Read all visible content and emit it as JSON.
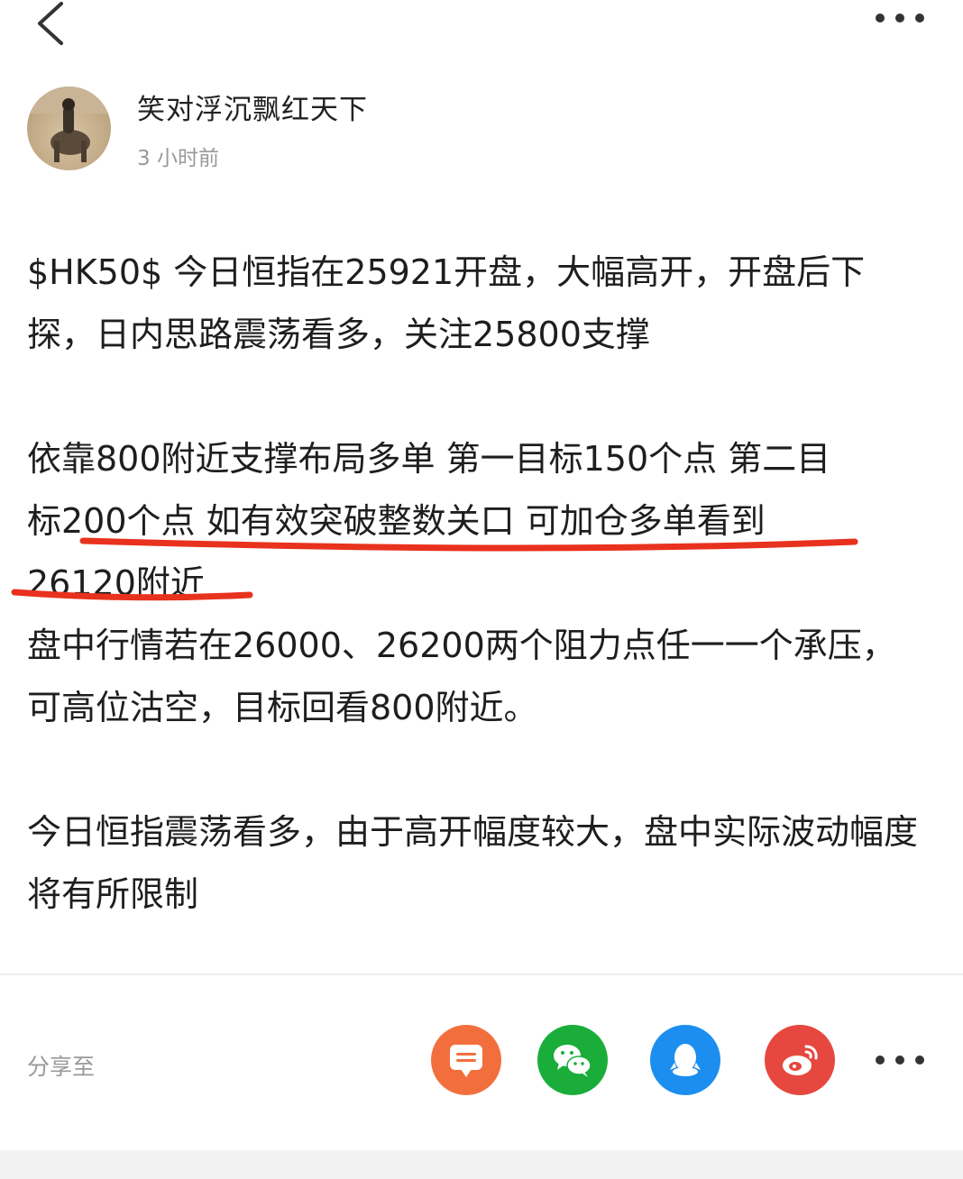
{
  "header": {
    "back_icon": "chevron-left-icon",
    "more_icon": "more-horizontal-icon"
  },
  "author": {
    "name": "笑对浮沉飘红天下",
    "time": "3 小时前"
  },
  "post": {
    "paragraph1": "$HK50$ 今日恒指在25921开盘，大幅高开，开盘后下探，日内思路震荡看多，关注25800支撑",
    "paragraph2_line1": "依靠800附近支撑布局多单 第一目标150个点 第二目",
    "paragraph2_line2": "标200个点 如有效突破整数关口 可加仓多单看到",
    "paragraph2_line3": "26120附近",
    "paragraph3": "盘中行情若在26000、26200两个阻力点任一一个承压，可高位沽空，目标回看800附近。",
    "paragraph4": "今日恒指震荡看多，由于高开幅度较大，盘中实际波动幅度将有所限制",
    "annotation_color": "#e8321e"
  },
  "share": {
    "label": "分享至",
    "targets": [
      {
        "name": "message-icon",
        "color": "#f26f3d"
      },
      {
        "name": "wechat-icon",
        "color": "#1aad3a"
      },
      {
        "name": "qq-icon",
        "color": "#1c8ef0"
      },
      {
        "name": "weibo-icon",
        "color": "#e6483f"
      }
    ],
    "more_icon": "more-horizontal-icon"
  }
}
